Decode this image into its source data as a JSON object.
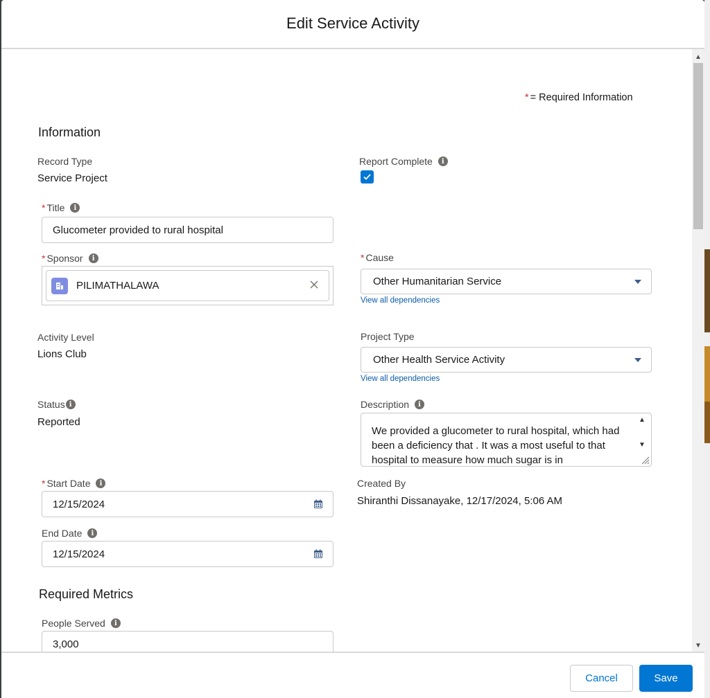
{
  "modal": {
    "title": "Edit Service Activity"
  },
  "required_info": {
    "star": "*",
    "text": "= Required Information"
  },
  "sections": {
    "information": "Information",
    "required_metrics": "Required Metrics"
  },
  "fields": {
    "record_type": {
      "label": "Record Type",
      "value": "Service Project"
    },
    "report_complete": {
      "label": "Report Complete",
      "checked": true
    },
    "title": {
      "label": "Title",
      "value": "Glucometer provided to rural hospital"
    },
    "sponsor": {
      "label": "Sponsor",
      "value": "PILIMATHALAWA"
    },
    "cause": {
      "label": "Cause",
      "value": "Other Humanitarian Service",
      "deps_link": "View all dependencies"
    },
    "activity_level": {
      "label": "Activity Level",
      "value": "Lions Club"
    },
    "project_type": {
      "label": "Project Type",
      "value": "Other Health Service Activity",
      "deps_link": "View all dependencies"
    },
    "status": {
      "label": "Status",
      "value": "Reported"
    },
    "description": {
      "label": "Description",
      "value": "We provided a glucometer to rural hospital, which had been a deficiency that . It was a most useful to that hospital to measure how much sugar is in"
    },
    "start_date": {
      "label": "Start Date",
      "value": "12/15/2024"
    },
    "created_by": {
      "label": "Created By",
      "value": "Shiranthi Dissanayake, 12/17/2024, 5:06 AM"
    },
    "end_date": {
      "label": "End Date",
      "value": "12/15/2024"
    },
    "people_served": {
      "label": "People Served",
      "value": "3,000"
    }
  },
  "footer": {
    "cancel_label": "Cancel",
    "save_label": "Save"
  },
  "icons": {
    "info": "info-icon",
    "calendar": "calendar-icon",
    "account": "account-icon",
    "clear": "close-icon",
    "dropdown": "chevron-down-icon"
  },
  "colors": {
    "brand": "#0176d3",
    "required": "#c23934",
    "link": "#0b5cab"
  }
}
